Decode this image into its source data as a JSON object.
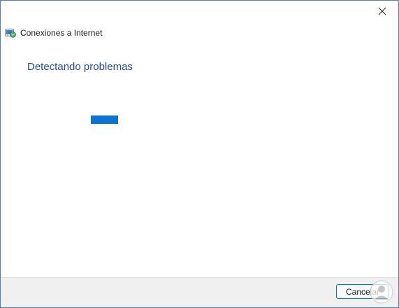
{
  "window": {
    "title": "Conexiones a Internet",
    "close_icon": "close-icon",
    "app_icon": "network-troubleshooter-icon"
  },
  "main": {
    "heading": "Detectando problemas",
    "progress_state": "indeterminate"
  },
  "footer": {
    "cancel_label": "Cancelar"
  },
  "colors": {
    "heading": "#1f4e96",
    "progress": "#0b73d8",
    "button_border": "#0078d4",
    "footer_bg": "#f0f0f0"
  }
}
